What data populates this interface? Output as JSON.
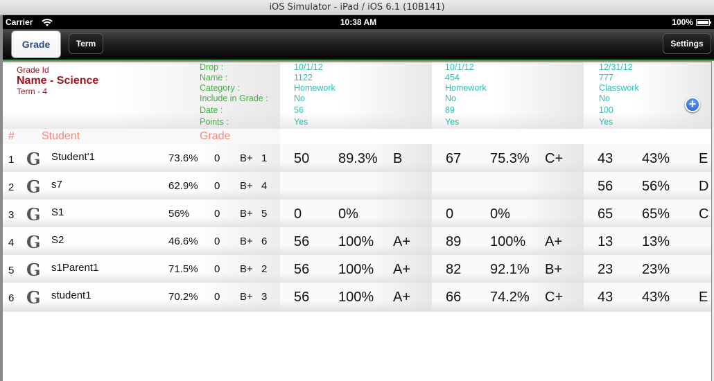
{
  "window_title": "iOS Simulator - iPad / iOS 6.1 (10B141)",
  "status_bar": {
    "carrier": "Carrier",
    "time": "10:38 AM",
    "battery": "100%"
  },
  "navbar": {
    "tabs": [
      {
        "label": "Grade",
        "selected": true
      },
      {
        "label": "Term",
        "selected": false
      }
    ],
    "settings_label": "Settings"
  },
  "grade_info": {
    "grade_id_label": "Grade Id",
    "name": "Name - Science",
    "term": "Term - 4"
  },
  "meta_labels": [
    "Drop :",
    "Name :",
    "Category :",
    "Include in Grade :",
    "Date :",
    "Points :"
  ],
  "assignments": [
    {
      "drop": "10/1/12",
      "name": "1122",
      "category": "Homework",
      "include": "No",
      "date": "56",
      "points": "Yes"
    },
    {
      "drop": "10/1/12",
      "name": "454",
      "category": "Homework",
      "include": "No",
      "date": "89",
      "points": "Yes"
    },
    {
      "drop": "12/31/12",
      "name": "777",
      "category": "Classwork",
      "include": "No",
      "date": "100",
      "points": "Yes"
    }
  ],
  "add_button_icon": "plus-circle-icon",
  "columns": {
    "num": "#",
    "student": "Student",
    "grade": "Grade"
  },
  "rows": [
    {
      "num": "1",
      "student": "Student'1",
      "pct": "73.6%",
      "zero": "0",
      "letter": "B+",
      "rank": "1",
      "a": [
        {
          "score": "50",
          "pct": "89.3%",
          "grade": "B"
        },
        {
          "score": "67",
          "pct": "75.3%",
          "grade": "C+"
        },
        {
          "score": "43",
          "pct": "43%",
          "grade": "E"
        }
      ]
    },
    {
      "num": "2",
      "student": "s7",
      "pct": "62.9%",
      "zero": "0",
      "letter": "B+",
      "rank": "4",
      "a": [
        {
          "score": "",
          "pct": "",
          "grade": ""
        },
        {
          "score": "",
          "pct": "",
          "grade": ""
        },
        {
          "score": "56",
          "pct": "56%",
          "grade": "D"
        }
      ]
    },
    {
      "num": "3",
      "student": "S1",
      "pct": "56%",
      "zero": "0",
      "letter": "B+",
      "rank": "5",
      "a": [
        {
          "score": "0",
          "pct": "0%",
          "grade": ""
        },
        {
          "score": "0",
          "pct": "0%",
          "grade": ""
        },
        {
          "score": "65",
          "pct": "65%",
          "grade": "C"
        }
      ]
    },
    {
      "num": "4",
      "student": "S2",
      "pct": "46.6%",
      "zero": "0",
      "letter": "B+",
      "rank": "6",
      "a": [
        {
          "score": "56",
          "pct": "100%",
          "grade": "A+"
        },
        {
          "score": "89",
          "pct": "100%",
          "grade": "A+"
        },
        {
          "score": "13",
          "pct": "13%",
          "grade": ""
        }
      ]
    },
    {
      "num": "5",
      "student": "s1Parent1",
      "pct": "71.5%",
      "zero": "0",
      "letter": "B+",
      "rank": "2",
      "a": [
        {
          "score": "56",
          "pct": "100%",
          "grade": "A+"
        },
        {
          "score": "82",
          "pct": "92.1%",
          "grade": "B+"
        },
        {
          "score": "23",
          "pct": "23%",
          "grade": ""
        }
      ]
    },
    {
      "num": "6",
      "student": "student1",
      "pct": "70.2%",
      "zero": "0",
      "letter": "B+",
      "rank": "3",
      "a": [
        {
          "score": "56",
          "pct": "100%",
          "grade": "A+"
        },
        {
          "score": "66",
          "pct": "74.2%",
          "grade": "C+"
        },
        {
          "score": "43",
          "pct": "43%",
          "grade": "E"
        }
      ]
    }
  ]
}
